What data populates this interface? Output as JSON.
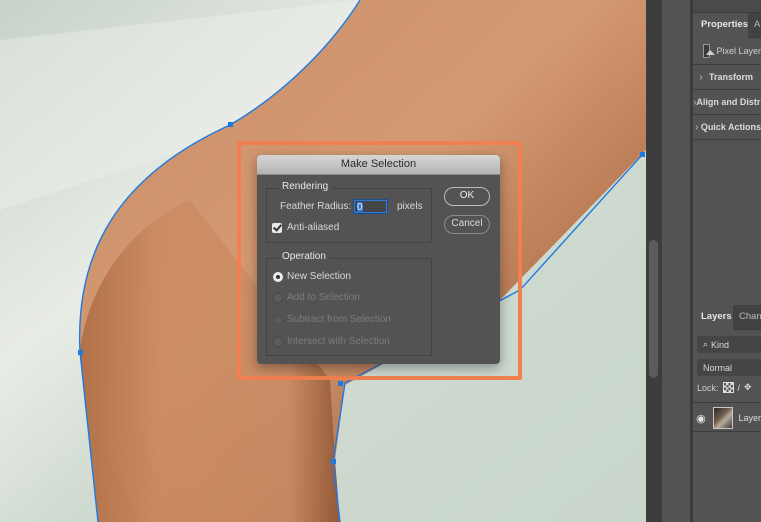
{
  "dialog": {
    "title": "Make Selection",
    "rendering": {
      "legend": "Rendering",
      "feather_label": "Feather Radius:",
      "feather_value": "0",
      "feather_unit": "pixels",
      "anti_aliased_label": "Anti-aliased",
      "anti_aliased_checked": true
    },
    "operation": {
      "legend": "Operation",
      "options": [
        {
          "label": "New Selection",
          "selected": true,
          "enabled": true
        },
        {
          "label": "Add to Selection",
          "selected": false,
          "enabled": false
        },
        {
          "label": "Subtract from Selection",
          "selected": false,
          "enabled": false
        },
        {
          "label": "Intersect with Selection",
          "selected": false,
          "enabled": false
        }
      ]
    },
    "ok_label": "OK",
    "cancel_label": "Cancel"
  },
  "properties_panel": {
    "tabs": [
      "Properties",
      "A"
    ],
    "layer_type": "Pixel Layer",
    "sections": [
      "Transform",
      "Align and Distribute",
      "Quick Actions"
    ]
  },
  "layers_panel": {
    "tabs": [
      "Layers",
      "Channels"
    ],
    "filter_label": "Kind",
    "blend_mode": "Normal",
    "lock_label": "Lock:",
    "layers": [
      {
        "name": "Layer",
        "visible": true
      }
    ]
  },
  "colors": {
    "highlight": "#f08050",
    "path": "#1f7ae0",
    "dialog_bg": "#535353"
  }
}
